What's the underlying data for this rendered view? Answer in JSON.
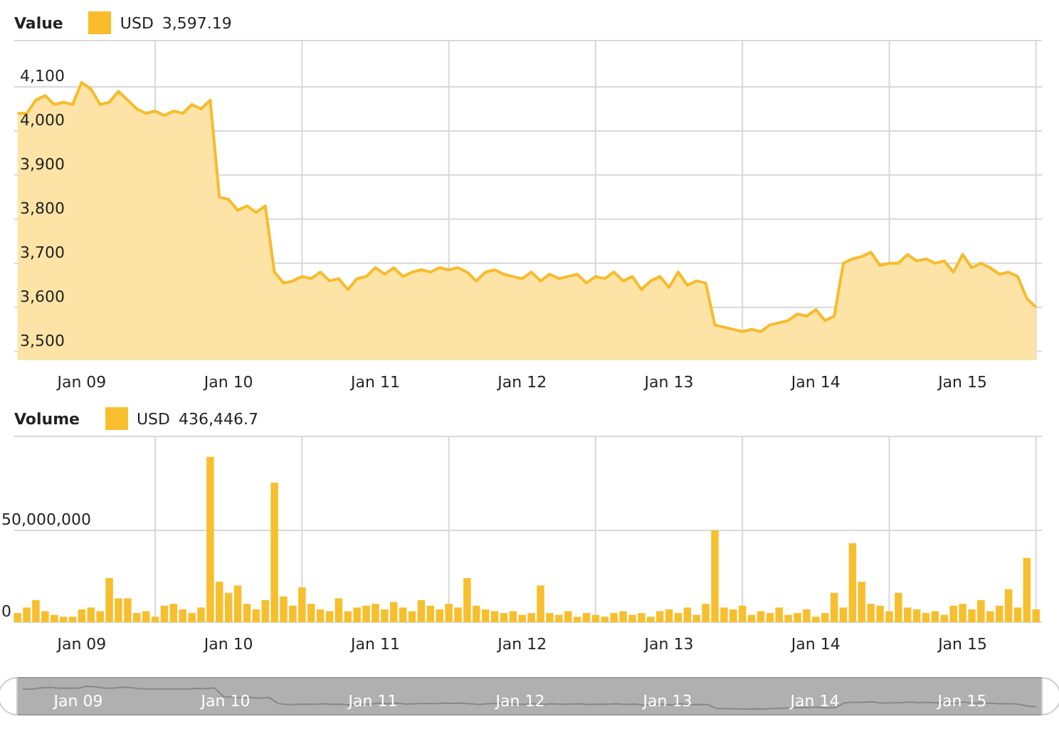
{
  "value_panel": {
    "title": "Value",
    "legend": {
      "reading": "3,597.19"
    },
    "chart_data": {
      "type": "area",
      "grid": true,
      "ylim": [
        3480,
        4200
      ],
      "yticks": [
        {
          "value": 3500,
          "label": "3,500"
        },
        {
          "value": 3600,
          "label": "3,600"
        },
        {
          "value": 3700,
          "label": "3,700"
        },
        {
          "value": 3800,
          "label": "3,800"
        },
        {
          "value": 3900,
          "label": "3,900"
        },
        {
          "value": 4000,
          "label": "4,000"
        },
        {
          "value": 4100,
          "label": "4,100"
        }
      ],
      "categories": [
        null,
        null,
        null,
        null,
        null,
        null,
        null,
        "Jan 09",
        null,
        null,
        null,
        null,
        null,
        null,
        null,
        null,
        null,
        null,
        null,
        null,
        null,
        null,
        null,
        "Jan 10",
        null,
        null,
        null,
        null,
        null,
        null,
        null,
        null,
        null,
        null,
        null,
        null,
        null,
        null,
        null,
        "Jan 11",
        null,
        null,
        null,
        null,
        null,
        null,
        null,
        null,
        null,
        null,
        null,
        null,
        null,
        null,
        null,
        "Jan 12",
        null,
        null,
        null,
        null,
        null,
        null,
        null,
        null,
        null,
        null,
        null,
        null,
        null,
        null,
        null,
        "Jan 13",
        null,
        null,
        null,
        null,
        null,
        null,
        null,
        null,
        null,
        null,
        null,
        null,
        null,
        null,
        null,
        "Jan 14",
        null,
        null,
        null,
        null,
        null,
        null,
        null,
        null,
        null,
        null,
        null,
        null,
        null,
        null,
        null,
        "Jan 15",
        null,
        null,
        null,
        null,
        null,
        null,
        null,
        null
      ],
      "series": [
        {
          "name": "USD",
          "color": "#f7bb2b",
          "values": [
            4040,
            4040,
            4070,
            4080,
            4060,
            4065,
            4060,
            4110,
            4095,
            4060,
            4065,
            4090,
            4070,
            4050,
            4040,
            4045,
            4035,
            4045,
            4040,
            4060,
            4050,
            4070,
            3850,
            3845,
            3820,
            3830,
            3815,
            3830,
            3680,
            3655,
            3660,
            3670,
            3665,
            3680,
            3660,
            3665,
            3640,
            3665,
            3670,
            3690,
            3675,
            3690,
            3670,
            3680,
            3685,
            3680,
            3690,
            3685,
            3690,
            3680,
            3660,
            3680,
            3685,
            3675,
            3670,
            3665,
            3680,
            3660,
            3675,
            3665,
            3670,
            3675,
            3655,
            3670,
            3665,
            3680,
            3660,
            3670,
            3640,
            3660,
            3670,
            3645,
            3680,
            3650,
            3660,
            3655,
            3560,
            3555,
            3550,
            3545,
            3550,
            3545,
            3560,
            3565,
            3570,
            3585,
            3580,
            3595,
            3570,
            3580,
            3700,
            3710,
            3715,
            3725,
            3695,
            3700,
            3700,
            3720,
            3705,
            3710,
            3700,
            3705,
            3680,
            3720,
            3690,
            3700,
            3690,
            3675,
            3680,
            3670,
            3620,
            3600
          ]
        }
      ]
    }
  },
  "volume_panel": {
    "title": "Volume",
    "legend": {
      "reading": "436,446.7"
    },
    "chart_data": {
      "type": "bar",
      "grid": true,
      "ylim": [
        0,
        100000000
      ],
      "yticks": [
        {
          "value": 0,
          "label": "0"
        },
        {
          "value": 50000000,
          "label": "50,000,000"
        }
      ],
      "categories": [
        null,
        null,
        null,
        null,
        null,
        null,
        null,
        "Jan 09",
        null,
        null,
        null,
        null,
        null,
        null,
        null,
        null,
        null,
        null,
        null,
        null,
        null,
        null,
        null,
        "Jan 10",
        null,
        null,
        null,
        null,
        null,
        null,
        null,
        null,
        null,
        null,
        null,
        null,
        null,
        null,
        null,
        "Jan 11",
        null,
        null,
        null,
        null,
        null,
        null,
        null,
        null,
        null,
        null,
        null,
        null,
        null,
        null,
        null,
        "Jan 12",
        null,
        null,
        null,
        null,
        null,
        null,
        null,
        null,
        null,
        null,
        null,
        null,
        null,
        null,
        null,
        "Jan 13",
        null,
        null,
        null,
        null,
        null,
        null,
        null,
        null,
        null,
        null,
        null,
        null,
        null,
        null,
        null,
        "Jan 14",
        null,
        null,
        null,
        null,
        null,
        null,
        null,
        null,
        null,
        null,
        null,
        null,
        null,
        null,
        null,
        "Jan 15",
        null,
        null,
        null,
        null,
        null,
        null,
        null,
        null
      ],
      "series": [
        {
          "name": "USD",
          "color": "#f7bf2e",
          "values": [
            5000000,
            8000000,
            12000000,
            6000000,
            4000000,
            3000000,
            3000000,
            7000000,
            8000000,
            6000000,
            24000000,
            13000000,
            13000000,
            5000000,
            6000000,
            3000000,
            9000000,
            10000000,
            7000000,
            5000000,
            8000000,
            90000000,
            22000000,
            16000000,
            20000000,
            10000000,
            7000000,
            12000000,
            76000000,
            14000000,
            9000000,
            19000000,
            10000000,
            7000000,
            6000000,
            13000000,
            6000000,
            8000000,
            9000000,
            10000000,
            7000000,
            11000000,
            8000000,
            6000000,
            12000000,
            9000000,
            7000000,
            10000000,
            8000000,
            24000000,
            9000000,
            7000000,
            6000000,
            5000000,
            6000000,
            4000000,
            5000000,
            20000000,
            5000000,
            4000000,
            6000000,
            3000000,
            5000000,
            4000000,
            3000000,
            5000000,
            6000000,
            4000000,
            5000000,
            3000000,
            6000000,
            7000000,
            5000000,
            8000000,
            4000000,
            10000000,
            50000000,
            8000000,
            7000000,
            9000000,
            4000000,
            6000000,
            5000000,
            8000000,
            4000000,
            5000000,
            7000000,
            3000000,
            5000000,
            16000000,
            8000000,
            43000000,
            22000000,
            10000000,
            9000000,
            6000000,
            16000000,
            8000000,
            7000000,
            5000000,
            6000000,
            4000000,
            9000000,
            10000000,
            7000000,
            12000000,
            6000000,
            9000000,
            18000000,
            8000000,
            35000000,
            7000000
          ]
        }
      ]
    }
  },
  "navigator": {
    "labels": [
      "Jan 09",
      "Jan 10",
      "Jan 11",
      "Jan 12",
      "Jan 13",
      "Jan 14",
      "Jan 15"
    ]
  }
}
